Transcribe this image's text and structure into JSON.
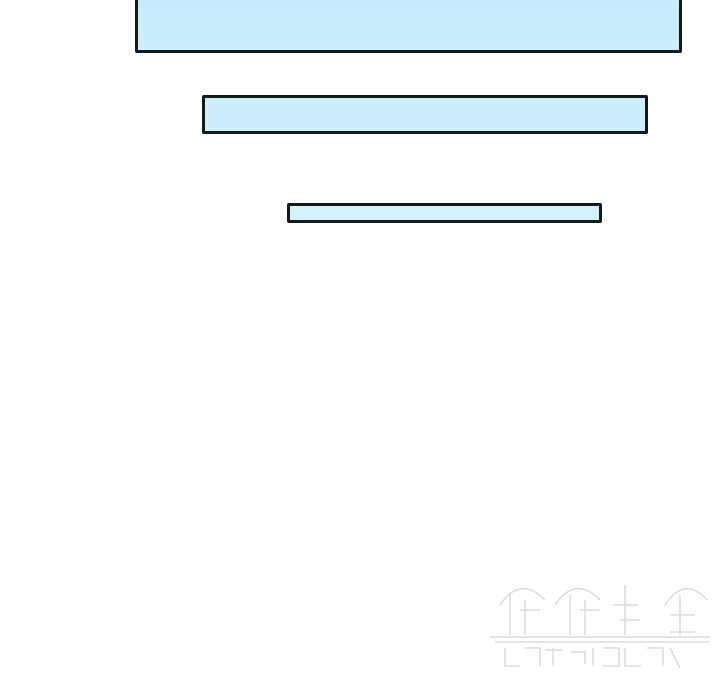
{
  "panels": [
    {
      "id": "caption-box-1",
      "fill": "#c8ecfb",
      "border": "#14191c"
    },
    {
      "id": "caption-box-2",
      "fill": "#cdeffb",
      "border": "#14191c"
    },
    {
      "id": "caption-box-3",
      "fill": "#d2f1fa",
      "border": "#14191c"
    }
  ],
  "watermark": {
    "color": "#e2e2e2",
    "icon": "watermark-logo"
  }
}
